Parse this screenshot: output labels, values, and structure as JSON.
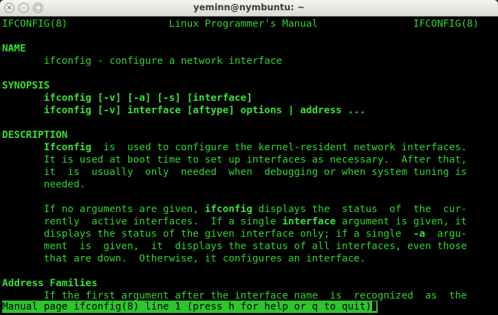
{
  "window": {
    "title": "yeminn@nymbuntu: ~",
    "buttons": {
      "close": "×",
      "minimize": "–",
      "maximize": "□"
    }
  },
  "man": {
    "header": "IFCONFIG(8)                 Linux Programmer's Manual                IFCONFIG(8)",
    "name_heading": "NAME",
    "name_line": "       ifconfig - configure a network interface",
    "synopsis_heading": "SYNOPSIS",
    "synopsis": [
      "       ifconfig [-v] [-a] [-s] [interface]",
      "       ifconfig [-v] interface [aftype] options | address ..."
    ],
    "description_heading": "DESCRIPTION",
    "desc_p1": [
      {
        "pre": "       ",
        "bold": "Ifconfig",
        "post": "  is  used to configure the kernel-resident network interfaces."
      },
      {
        "pre": "",
        "bold": "",
        "post": "       It is used at boot time to set up interfaces as necessary.  After that,"
      },
      {
        "pre": "",
        "bold": "",
        "post": "       it  is  usually  only  needed  when  debugging or when system tuning is"
      },
      {
        "pre": "",
        "bold": "",
        "post": "       needed."
      }
    ],
    "desc_p2": [
      {
        "pre": "       If no arguments are given, ",
        "bold": "ifconfig",
        "post": " displays the  status  of  the  cur‐"
      },
      {
        "pre": "       rently  active interfaces.  If a single ",
        "bold": "interface",
        "post": " argument is given, it"
      },
      {
        "pre": "       displays the status of the given interface only; if a single  ",
        "bold": "-a",
        "post": "  argu‐"
      },
      {
        "pre": "",
        "bold": "",
        "post": "       ment  is  given,  it  displays the status of all interfaces, even those"
      },
      {
        "pre": "",
        "bold": "",
        "post": "       that are down.  Otherwise, it configures an interface."
      }
    ],
    "address_heading": "Address Families",
    "address_line": "       If the first argument after the interface name  is  recognized  as  the",
    "status": "Manual page ifconfig(8) line 1 (press h for help or q to quit)"
  }
}
